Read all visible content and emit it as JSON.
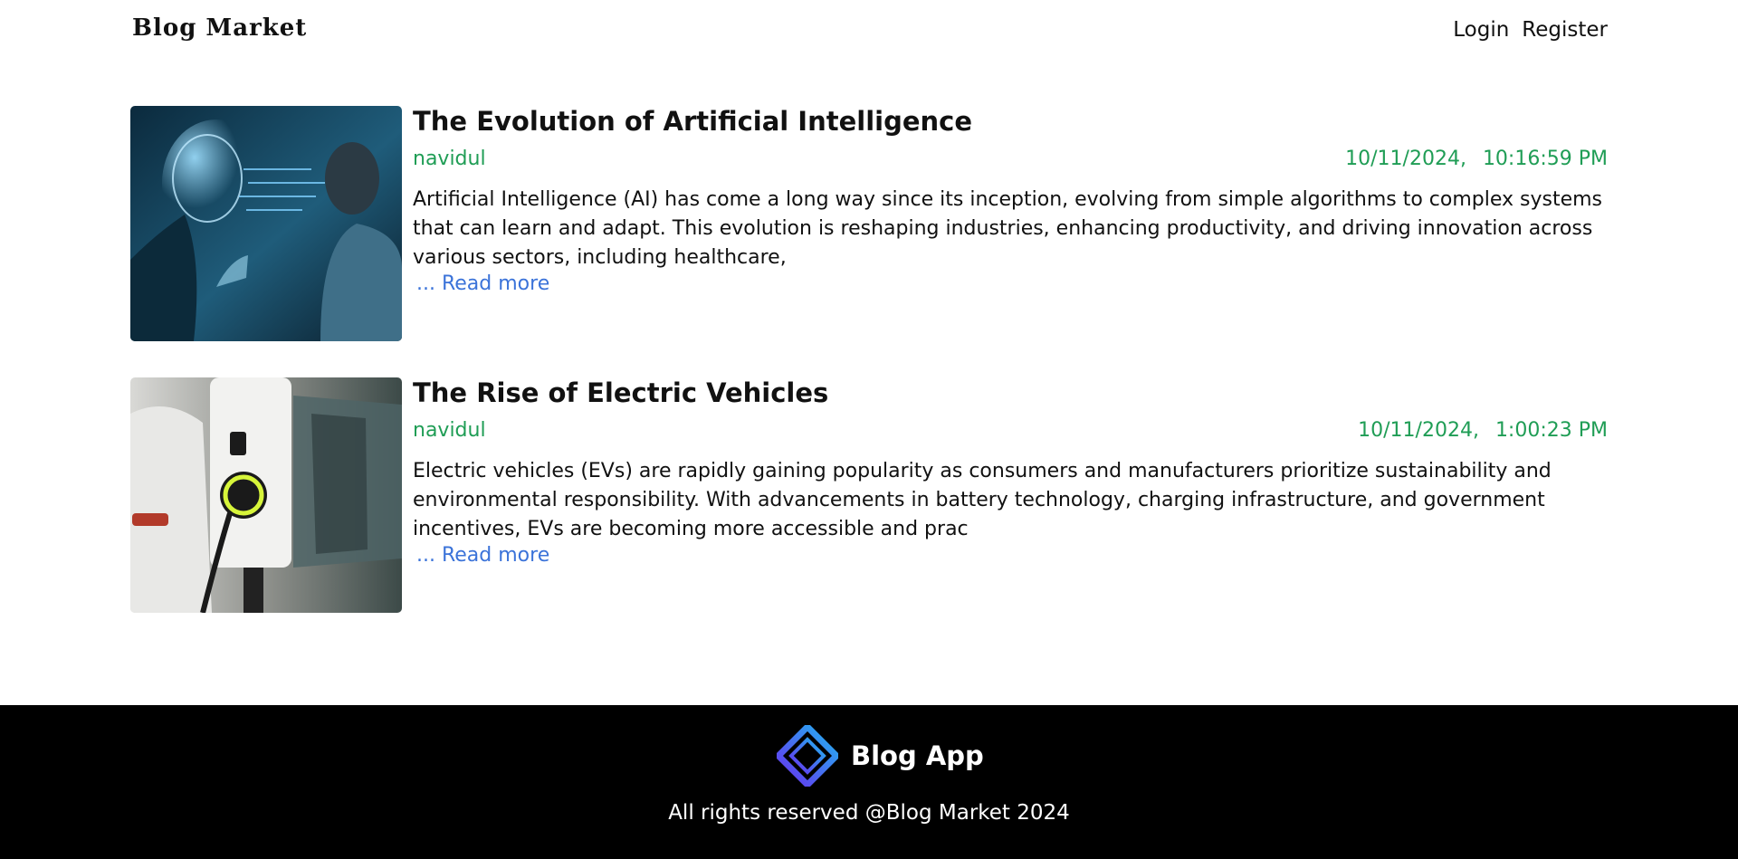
{
  "header": {
    "logo": "Blog Market",
    "nav": {
      "login": "Login",
      "register": "Register"
    }
  },
  "posts": [
    {
      "title": "The Evolution of Artificial Intelligence",
      "author": "navidul",
      "date": "10/11/2024,",
      "time": "10:16:59 PM",
      "excerpt": "Artificial Intelligence (AI) has come a long way since its inception, evolving from simple algorithms to complex systems that can learn and adapt. This evolution is reshaping industries, enhancing productivity, and driving innovation across various sectors, including healthcare,",
      "read_more": "... Read more",
      "image": "ai-human-face-to-face-image"
    },
    {
      "title": "The Rise of Electric Vehicles",
      "author": "navidul",
      "date": "10/11/2024,",
      "time": "1:00:23 PM",
      "excerpt": "Electric vehicles (EVs) are rapidly gaining popularity as consumers and manufacturers prioritize sustainability and environmental responsibility. With advancements in battery technology, charging infrastructure, and government incentives, EVs are becoming more accessible and prac",
      "read_more": "... Read more",
      "image": "ev-charging-station-image"
    }
  ],
  "footer": {
    "brand": "Blog App",
    "rights": "All rights reserved @Blog Market 2024",
    "icon": "diamond-logo-icon"
  },
  "colors": {
    "accent_green": "#1f9d55",
    "link_blue": "#3b73d9",
    "footer_bg": "#000000"
  }
}
